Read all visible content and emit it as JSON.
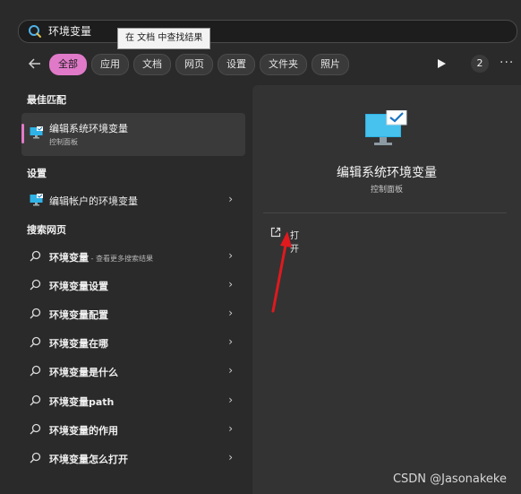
{
  "search": {
    "query": "环境变量",
    "tooltip": "在 文档 中查找结果"
  },
  "filters": {
    "chips": [
      "全部",
      "应用",
      "文档",
      "网页",
      "设置",
      "文件夹",
      "照片"
    ],
    "count": "2"
  },
  "left": {
    "best_match_heading": "最佳匹配",
    "best_match": {
      "title": "编辑系统环境变量",
      "subtitle": "控制面板"
    },
    "settings_heading": "设置",
    "settings_item": "编辑帐户的环境变量",
    "web_heading": "搜索网页",
    "web_first": {
      "term": "环境变量",
      "hint": " - 查看更多搜索结果"
    },
    "web_items": [
      "环境变量设置",
      "环境变量配置",
      "环境变量在哪",
      "环境变量是什么",
      "环境变量path",
      "环境变量的作用",
      "环境变量怎么打开"
    ]
  },
  "detail": {
    "title": "编辑系统环境变量",
    "subtitle": "控制面板",
    "open_label": "打开"
  },
  "watermark": "CSDN @Jasonakeke",
  "colors": {
    "accent": "#e07ac8",
    "arrow": "#e0191e",
    "monitor": "#2fb3e6"
  }
}
